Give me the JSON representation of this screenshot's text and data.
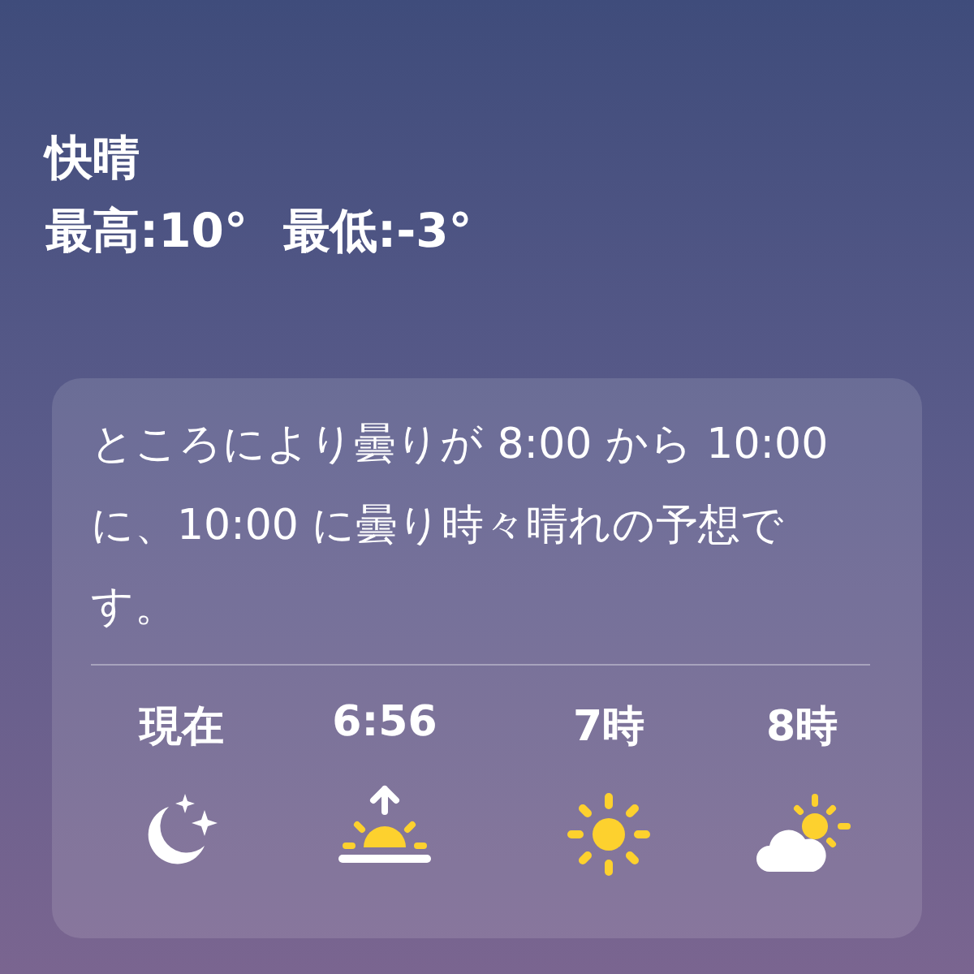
{
  "current": {
    "condition": "快晴",
    "high": "最高:10°",
    "low": "最低:-3°"
  },
  "forecast": {
    "summary": "ところにより曇りが 8:00 から 10:00 に、10:00 に曇り時々晴れの予想です。",
    "hours": [
      {
        "time": "現在",
        "kind": "moon"
      },
      {
        "time": "6:56",
        "kind": "sunrise"
      },
      {
        "time": "7時",
        "kind": "sun"
      },
      {
        "time": "8時",
        "kind": "partly-cloudy"
      }
    ]
  }
}
